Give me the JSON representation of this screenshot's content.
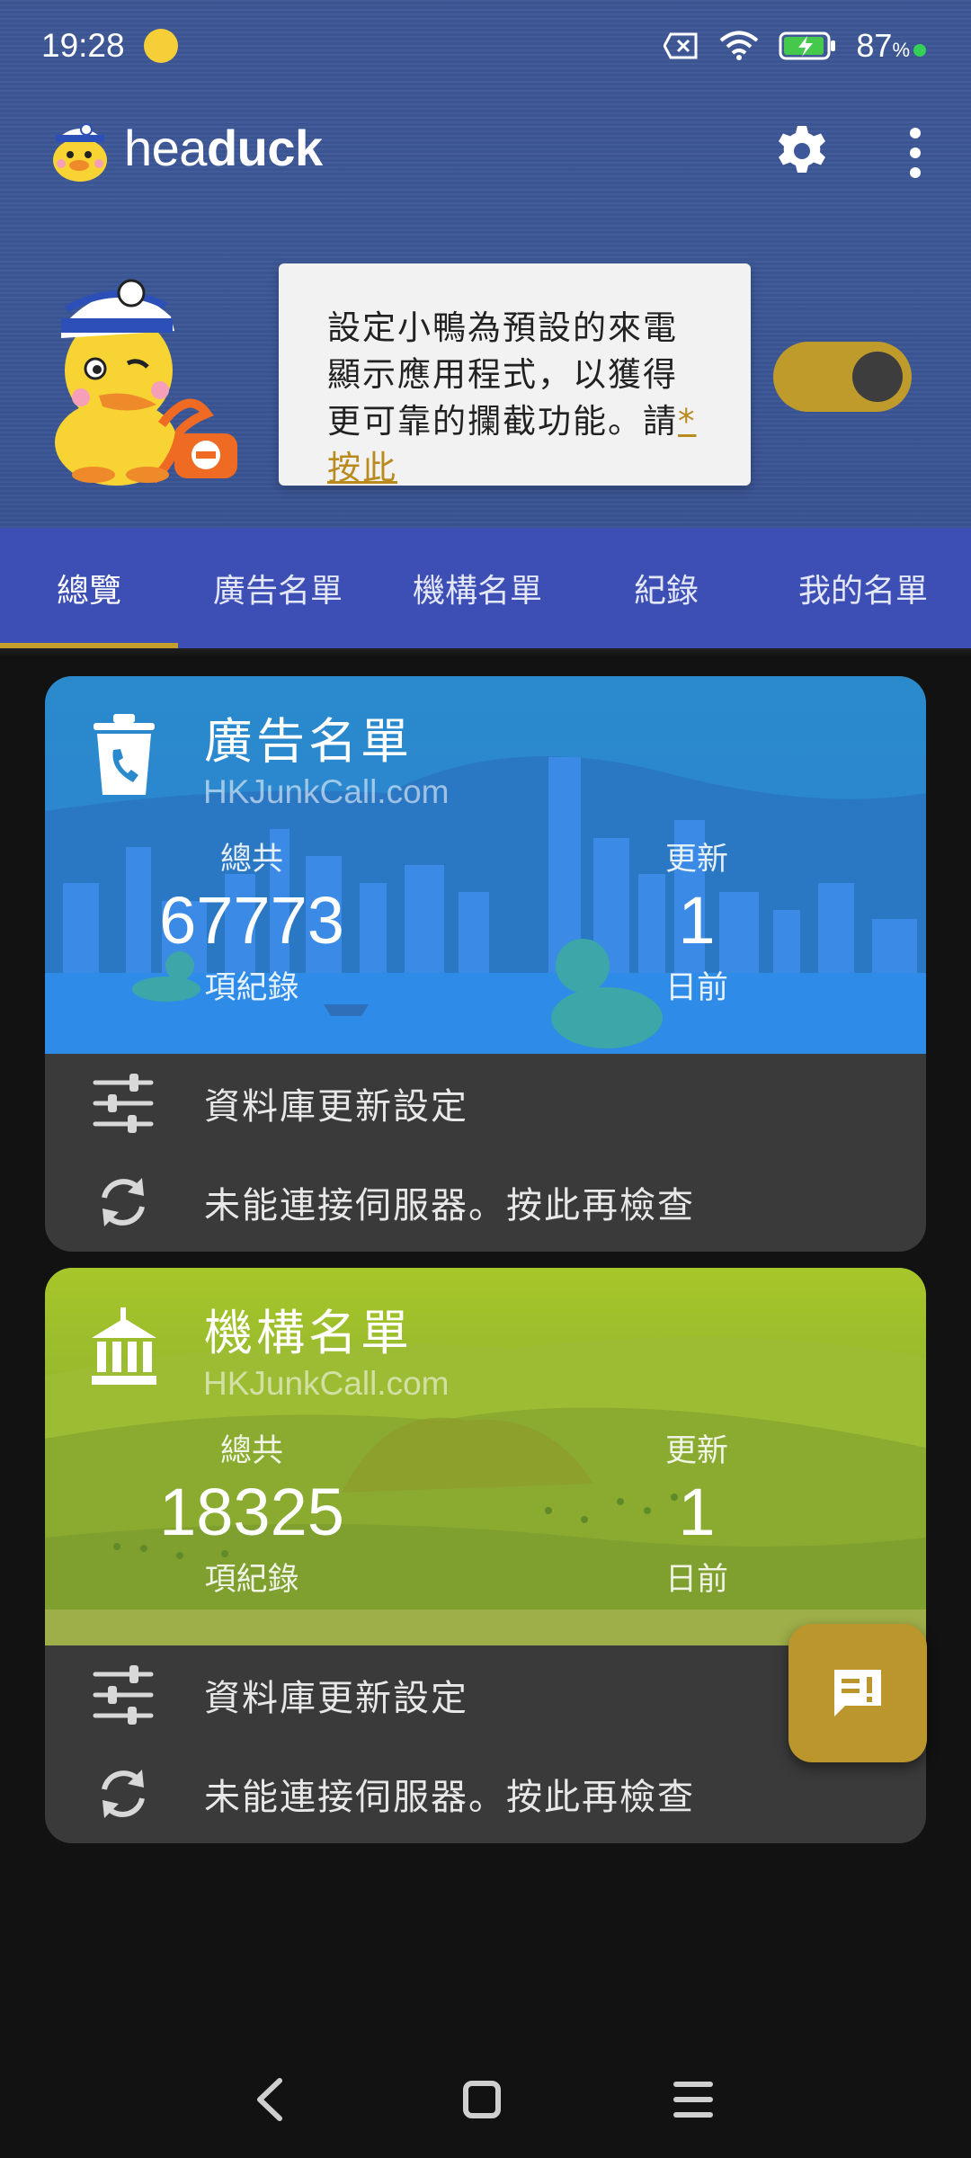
{
  "status_bar": {
    "time": "19:28",
    "battery_percent": "87",
    "battery_unit": "%"
  },
  "app_bar": {
    "name_light": "hea",
    "name_bold": "duck"
  },
  "banner": {
    "message": "設定小鴨為預設的來電顯示應用程式，以獲得更可靠的攔截功能。請",
    "link_text": "*按此",
    "toggle_on": true
  },
  "tabs": [
    {
      "label": "總覽",
      "active": true
    },
    {
      "label": "廣告名單",
      "active": false
    },
    {
      "label": "機構名單",
      "active": false
    },
    {
      "label": "紀錄",
      "active": false
    },
    {
      "label": "我的名單",
      "active": false
    }
  ],
  "cards": [
    {
      "title": "廣告名單",
      "source": "HKJunkCall.com",
      "total_label": "總共",
      "total_value": "67773",
      "total_unit": "項紀錄",
      "update_label": "更新",
      "update_value": "1",
      "update_unit": "日前",
      "settings_label": "資料庫更新設定",
      "status_label": "未能連接伺服器。按此再檢查"
    },
    {
      "title": "機構名單",
      "source": "HKJunkCall.com",
      "total_label": "總共",
      "total_value": "18325",
      "total_unit": "項紀錄",
      "update_label": "更新",
      "update_value": "1",
      "update_unit": "日前",
      "settings_label": "資料庫更新設定",
      "status_label": "未能連接伺服器。按此再檢查"
    }
  ],
  "colors": {
    "header_blue": "#3d5898",
    "tab_bar": "#3d4fb5",
    "accent_gold": "#bf9b2c",
    "card_dark": "#3a3a3a"
  }
}
